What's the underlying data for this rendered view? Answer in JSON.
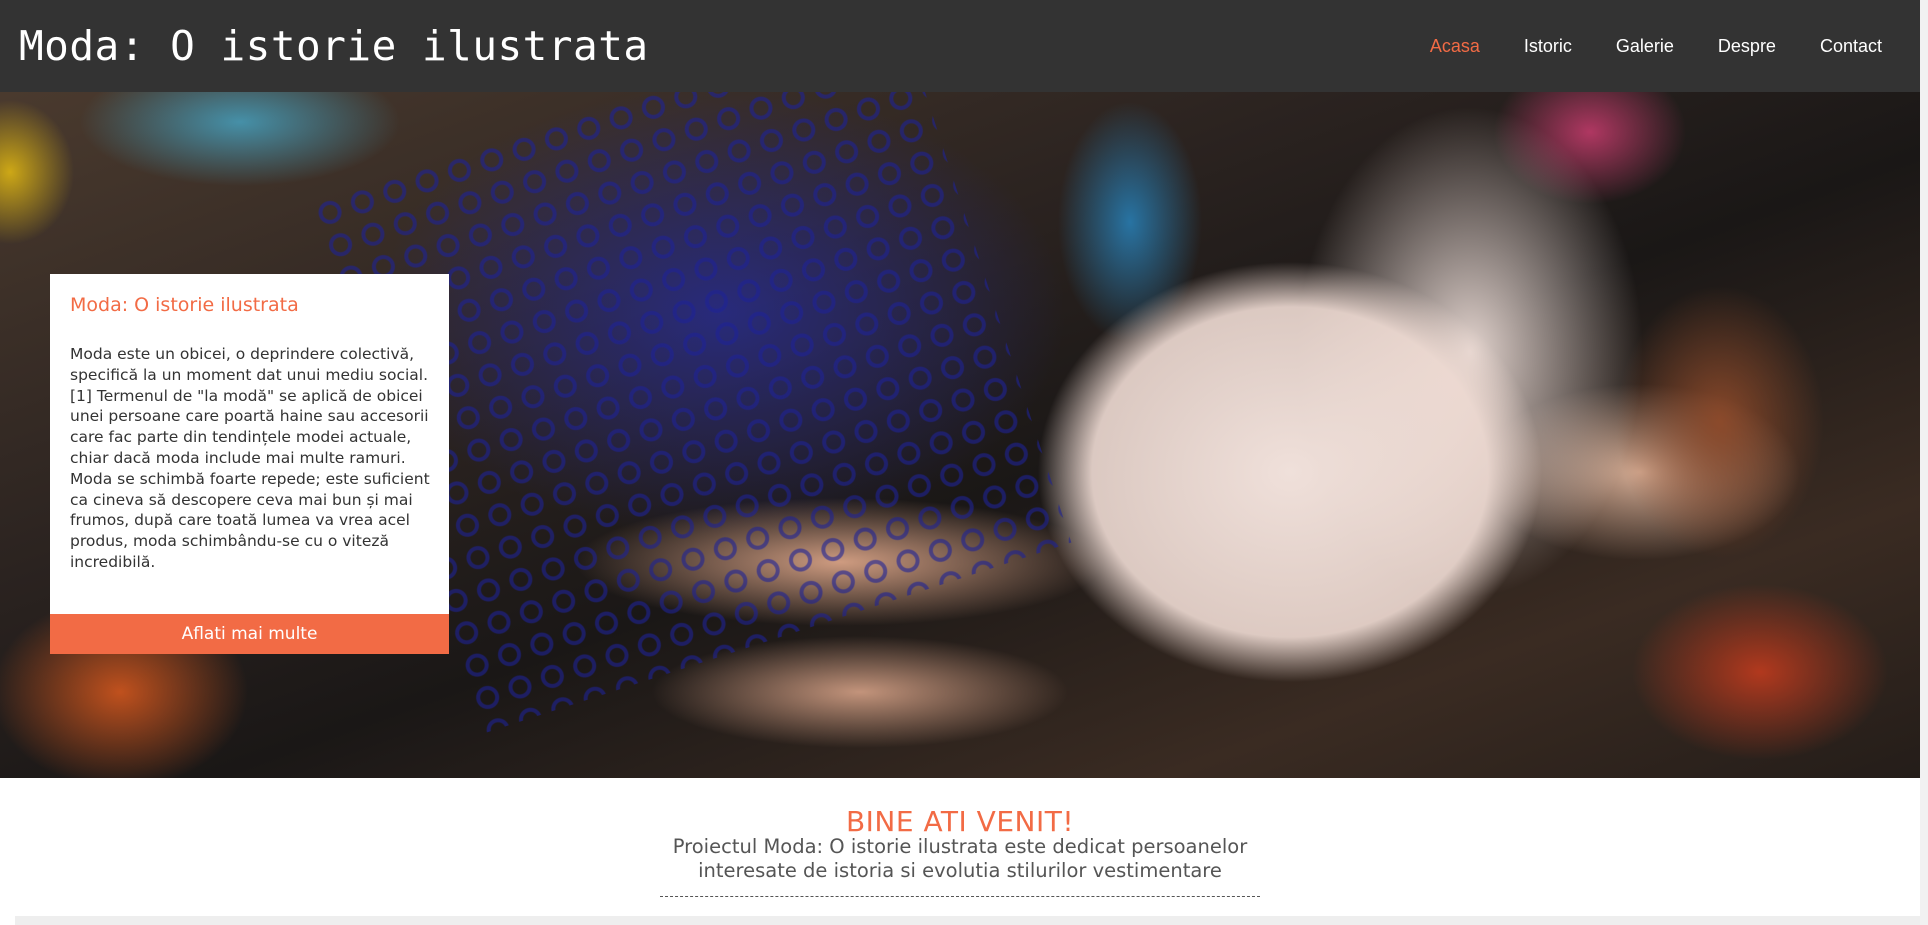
{
  "header": {
    "site_title": "Moda: O istorie ilustrata",
    "nav": [
      {
        "label": "Acasa",
        "active": true
      },
      {
        "label": "Istoric",
        "active": false
      },
      {
        "label": "Galerie",
        "active": false
      },
      {
        "label": "Despre",
        "active": false
      },
      {
        "label": "Contact",
        "active": false
      }
    ]
  },
  "hero": {
    "card": {
      "title": "Moda: O istorie ilustrata",
      "text": "Moda este un obicei, o deprindere colectivă, specifică la un moment dat unui mediu social.[1] Termenul de \"la modă\" se aplică de obicei unei persoane care poartă haine sau accesorii care fac parte din tendințele modei actuale, chiar dacă moda include mai multe ramuri. Moda se schimbă foarte repede; este suficient ca cineva să descopere ceva mai bun și mai frumos, după care toată lumea va vrea acel produs, moda schimbându-se cu o viteză incredibilă.",
      "button_label": "Aflati mai multe"
    }
  },
  "welcome": {
    "title": "BINE ATI VENIT!",
    "text": "Proiectul Moda: O istorie ilustrata este dedicat persoanelor interesate de istoria si evolutia stilurilor vestimentare"
  },
  "colors": {
    "accent": "#f26b45",
    "header_bg": "#333333",
    "text": "#333333"
  }
}
